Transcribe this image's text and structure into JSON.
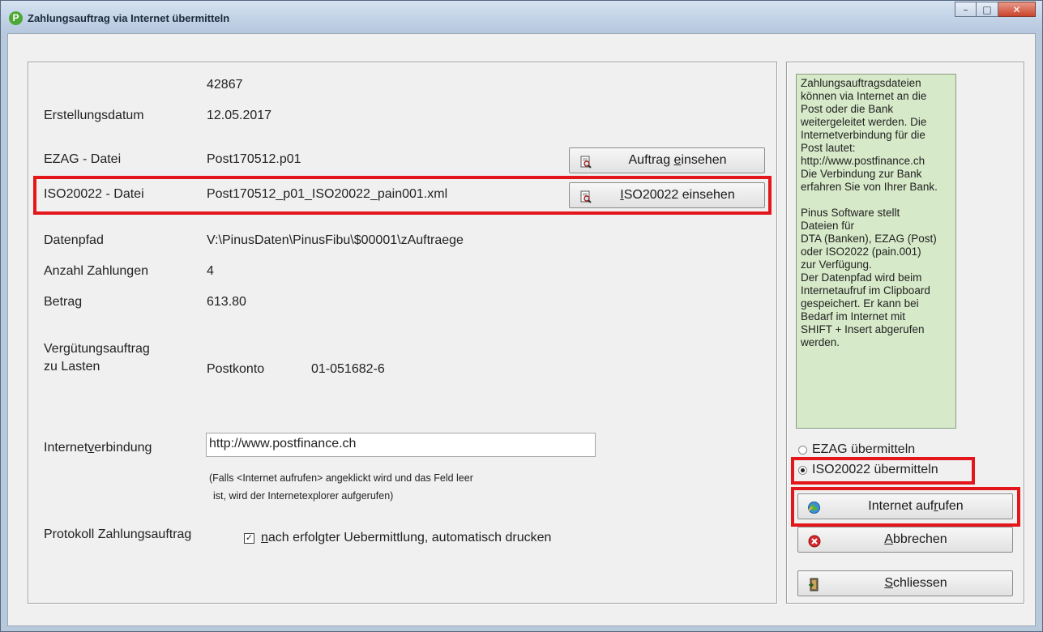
{
  "window": {
    "title": "Zahlungsauftrag via Internet übermitteln",
    "app_icon_letter": "P",
    "minimize_glyph": "–",
    "maximize_glyph": "□",
    "close_glyph": "✕"
  },
  "form": {
    "auftrag_nr": "42867",
    "erstellungsdatum_label": "Erstellungsdatum",
    "erstellungsdatum_value": "12.05.2017",
    "ezag_label": "EZAG - Datei",
    "ezag_value": "Post170512.p01",
    "iso_label": "ISO20022 - Datei",
    "iso_value": "Post170512_p01_ISO20022_pain001.xml",
    "datenpfad_label": "Datenpfad",
    "datenpfad_value": "V:\\PinusDaten\\PinusFibu\\$00001\\zAuftraege",
    "anzahl_label": "Anzahl Zahlungen",
    "anzahl_value": "4",
    "betrag_label": "Betrag",
    "betrag_value": "613.80",
    "verguetung_label_1": "Vergütungsauftrag",
    "verguetung_label_2": "zu Lasten",
    "konto_type": "Postkonto",
    "konto_number": "01-051682-6",
    "internet_label_pre": "Internet",
    "internet_label_u": "v",
    "internet_label_post": "erbindung",
    "internet_value": "http://www.postfinance.ch",
    "note_line_1": "(Falls <Internet aufrufen> angeklickt wird und das Feld leer",
    "note_line_2": "ist, wird der Internetexplorer aufgerufen)",
    "protokoll_label": "Protokoll Zahlungsauftrag",
    "protokoll_check_u": "n",
    "protokoll_check_rest": "ach erfolgter Uebermittlung, automatisch drucken",
    "protokoll_checked": true
  },
  "buttons": {
    "auftrag_pre": "Auftrag ",
    "auftrag_u": "e",
    "auftrag_post": "insehen",
    "iso_u": "I",
    "iso_post": "SO20022 einsehen",
    "internet_pre": "Internet auf",
    "internet_u": "r",
    "internet_post": "ufen",
    "abbrechen_u": "A",
    "abbrechen_post": "bbrechen",
    "schliessen_u": "S",
    "schliessen_post": "chliessen"
  },
  "info_text": {
    "paragraph_1": "Zahlungsauftragsdateien\nkönnen via Internet an die\nPost oder die Bank\nweitergeleitet werden. Die\nInternetverbindung für die\nPost lautet:\nhttp://www.postfinance.ch\nDie Verbindung zur Bank\nerfahren Sie von Ihrer Bank.",
    "paragraph_2": "Pinus Software stellt\nDateien für\nDTA (Banken), EZAG (Post)\noder ISO2022 (pain.001)\nzur Verfügung.\nDer Datenpfad wird beim\nInternetaufruf im Clipboard\ngespeichert. Er kann bei\nBedarf im Internet mit\nSHIFT + Insert abgerufen\nwerden."
  },
  "transfer_options": {
    "ezag_label": "EZAG übermitteln",
    "iso_label": "ISO20022 übermitteln",
    "selected": "iso"
  },
  "colors": {
    "highlight_red": "#e3161b",
    "info_background": "#d6e9c8",
    "dialog_background": "#f0f0f0"
  },
  "icons": {
    "view_icon": "magnifier-document-icon",
    "internet_icon": "globe-icon",
    "cancel_icon": "red-x-circle-icon",
    "exit_icon": "door-exit-icon"
  }
}
